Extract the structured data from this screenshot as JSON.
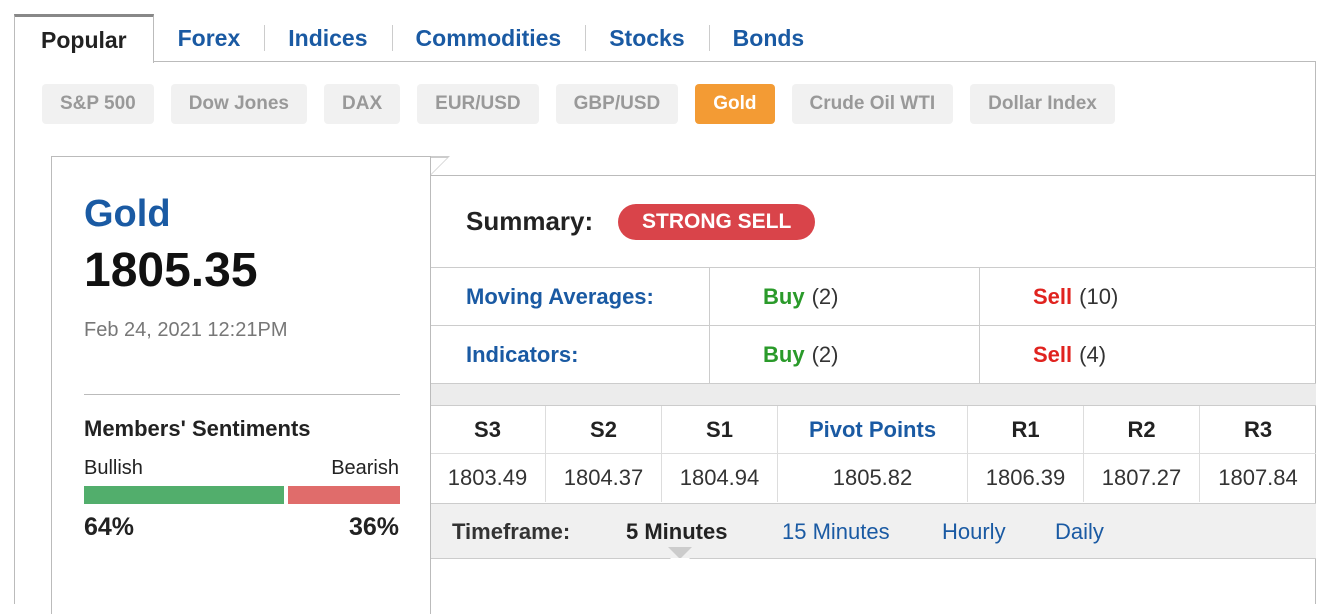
{
  "main_tabs": [
    {
      "label": "Popular",
      "active": true
    },
    {
      "label": "Forex",
      "active": false
    },
    {
      "label": "Indices",
      "active": false
    },
    {
      "label": "Commodities",
      "active": false
    },
    {
      "label": "Stocks",
      "active": false
    },
    {
      "label": "Bonds",
      "active": false
    }
  ],
  "sub_tabs": [
    {
      "label": "S&P 500",
      "active": false
    },
    {
      "label": "Dow Jones",
      "active": false
    },
    {
      "label": "DAX",
      "active": false
    },
    {
      "label": "EUR/USD",
      "active": false
    },
    {
      "label": "GBP/USD",
      "active": false
    },
    {
      "label": "Gold",
      "active": true
    },
    {
      "label": "Crude Oil WTI",
      "active": false
    },
    {
      "label": "Dollar Index",
      "active": false
    }
  ],
  "instrument": {
    "name": "Gold",
    "price": "1805.35",
    "datetime": "Feb 24, 2021 12:21PM"
  },
  "sentiment": {
    "title": "Members' Sentiments",
    "bullish_label": "Bullish",
    "bearish_label": "Bearish",
    "bullish_pct": "64%",
    "bearish_pct": "36%",
    "bullish_value": 64,
    "bearish_value": 36
  },
  "summary": {
    "label": "Summary:",
    "signal": "STRONG SELL"
  },
  "technicals": [
    {
      "label": "Moving Averages:",
      "buy_word": "Buy",
      "buy_count": "(2)",
      "sell_word": "Sell",
      "sell_count": "(10)"
    },
    {
      "label": "Indicators:",
      "buy_word": "Buy",
      "buy_count": "(2)",
      "sell_word": "Sell",
      "sell_count": "(4)"
    }
  ],
  "pivots": {
    "headers": [
      "S3",
      "S2",
      "S1",
      "Pivot Points",
      "R1",
      "R2",
      "R3"
    ],
    "values": [
      "1803.49",
      "1804.37",
      "1804.94",
      "1805.82",
      "1806.39",
      "1807.27",
      "1807.84"
    ]
  },
  "timeframe": {
    "label": "Timeframe:",
    "options": [
      {
        "label": "5 Minutes",
        "active": true
      },
      {
        "label": "15 Minutes",
        "active": false
      },
      {
        "label": "Hourly",
        "active": false
      },
      {
        "label": "Daily",
        "active": false
      }
    ]
  },
  "colors": {
    "link_blue": "#1a5aa3",
    "active_pill": "#f39b34",
    "strong_sell": "#d9444a",
    "buy_green": "#2a9a2a",
    "sell_red": "#e0231f",
    "bullish_bar": "#52ae6c",
    "bearish_bar": "#e06c6b"
  }
}
